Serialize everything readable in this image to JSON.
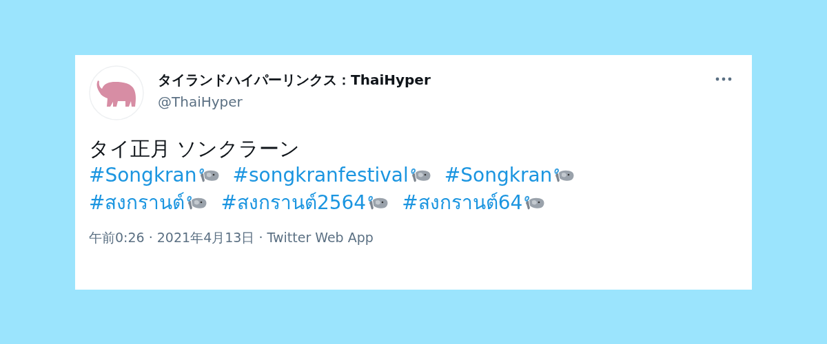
{
  "tweet": {
    "display_name": "タイランドハイパーリンクス：ThaiHyper",
    "handle": "@ThaiHyper",
    "text": "タイ正月 ソンクラーン",
    "hashtag_rows": [
      [
        {
          "text": "#Songkran"
        },
        {
          "text": "#songkranfestival"
        },
        {
          "text": "#Songkran"
        }
      ],
      [
        {
          "text": "#สงกรานต์"
        },
        {
          "text": "#สงกรานต์2564"
        },
        {
          "text": "#สงกรานต์64"
        }
      ]
    ],
    "footer": "午前0:26 · 2021年4月13日 · Twitter Web App"
  }
}
